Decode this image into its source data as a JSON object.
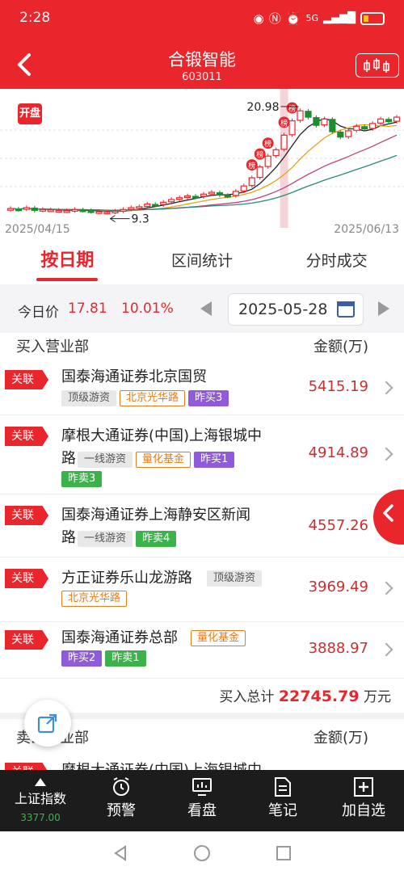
{
  "status": {
    "time": "2:28",
    "signal": "5G"
  },
  "header": {
    "title": "合锻智能",
    "code": "603011"
  },
  "chart": {
    "badge": "开盘",
    "start_date": "2025/04/15",
    "end_date": "2025/06/13",
    "high_label": "20.98",
    "low_label": "9.3",
    "marker": "榜"
  },
  "chart_data": {
    "type": "candlestick",
    "x_start": "2025/04/15",
    "x_end": "2025/06/13",
    "annotated_high": 20.98,
    "annotated_low": 9.3,
    "closes": [
      9.7,
      9.6,
      9.8,
      9.5,
      9.6,
      9.55,
      9.5,
      9.45,
      9.6,
      9.5,
      9.4,
      9.35,
      9.3,
      9.4,
      9.6,
      9.8,
      9.9,
      10.2,
      10.1,
      10.4,
      10.7,
      10.9,
      11.1,
      11.0,
      11.3,
      11.5,
      11.2,
      11.1,
      11.6,
      12.2,
      13.1,
      14.3,
      15.5,
      16.2,
      17.81,
      19.4,
      20.5,
      19.8,
      18.9,
      19.6,
      18.2,
      17.6,
      18.3,
      18.8,
      18.5,
      19.1,
      19.6,
      19.3,
      19.8
    ]
  },
  "tabs": [
    {
      "label": "按日期"
    },
    {
      "label": "区间统计"
    },
    {
      "label": "分时成交"
    }
  ],
  "datebar": {
    "label": "今日价",
    "price": "17.81",
    "pct": "10.01%",
    "date": "2025-05-28"
  },
  "buy": {
    "header_left": "买入营业部",
    "header_right": "金额(万)",
    "follow": "关联",
    "rows": [
      {
        "name": "国泰海通证券北京国贸",
        "amount": "5415.19",
        "tags": [
          "顶级游资",
          "北京光华路",
          "昨买3"
        ]
      },
      {
        "name": "摩根大通证券(中国)上海银城中",
        "name2": "路",
        "amount": "4914.89",
        "tags": [
          "一线游资",
          "量化基金",
          "昨买1",
          "昨卖3"
        ]
      },
      {
        "name": "国泰海通证券上海静安区新闻",
        "name2": "路",
        "amount": "4557.26",
        "tags": [
          "一线游资",
          "昨卖4"
        ]
      },
      {
        "name": "方正证券乐山龙游路",
        "amount": "3969.49",
        "tags": [
          "顶级游资",
          "北京光华路"
        ]
      },
      {
        "name": "国泰海通证券总部",
        "amount": "3888.97",
        "tags": [
          "量化基金",
          "昨买2",
          "昨卖1"
        ]
      }
    ],
    "total_label": "买入总计",
    "total_value": "22745.79",
    "total_unit": "万元"
  },
  "sell": {
    "header_left": "卖出营业部",
    "header_right": "金额(万)",
    "first_name": "摩根大通证券(中国)上海银城中"
  },
  "bottom_nav": [
    {
      "label": "上证指数",
      "sub": "3377.00"
    },
    {
      "label": "预警"
    },
    {
      "label": "看盘"
    },
    {
      "label": "笔记"
    },
    {
      "label": "加自选"
    }
  ],
  "colors": {
    "brand": "#e8262c",
    "up": "#e8262c",
    "down": "#1a8f2c",
    "ma5": "#222222",
    "ma10": "#e8a21b",
    "ma20": "#c0417d",
    "ma30": "#2a8a7a"
  }
}
